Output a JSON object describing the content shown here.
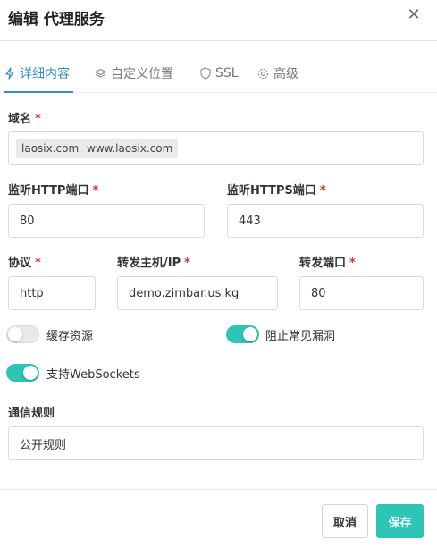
{
  "dialog": {
    "title": "编辑 代理服务",
    "close_icon": "close-icon"
  },
  "tabs": [
    {
      "label": "详细内容",
      "icon": "bolt-icon",
      "active": true
    },
    {
      "label": "自定义位置",
      "icon": "layers-icon",
      "active": false
    },
    {
      "label": "SSL",
      "icon": "shield-icon",
      "active": false
    },
    {
      "label": "高级",
      "icon": "gear-icon",
      "active": false
    }
  ],
  "form": {
    "domain": {
      "label": "域名",
      "required_mark": "*",
      "tags": [
        "laosix.com",
        "www.laosix.com"
      ]
    },
    "http_port": {
      "label": "监听HTTP端口",
      "required_mark": "*",
      "value": "80"
    },
    "https_port": {
      "label": "监听HTTPS端口",
      "required_mark": "*",
      "value": "443"
    },
    "protocol": {
      "label": "协议",
      "required_mark": "*",
      "value": "http"
    },
    "forward_host": {
      "label": "转发主机/IP",
      "required_mark": "*",
      "value": "demo.zimbar.us.kg"
    },
    "forward_port": {
      "label": "转发端口",
      "required_mark": "*",
      "value": "80"
    },
    "toggles": {
      "cache": {
        "label": "缓存资源",
        "on": false
      },
      "block_exploits": {
        "label": "阻止常见漏洞",
        "on": true
      },
      "websockets": {
        "label": "支持WebSockets",
        "on": true
      }
    },
    "access_rule": {
      "label": "通信规则",
      "value": "公开规则"
    }
  },
  "footer": {
    "cancel_label": "取消",
    "save_label": "保存"
  },
  "colors": {
    "accent": "#2ec4b6",
    "tab_active": "#3c8dbc",
    "required": "#e03030"
  }
}
